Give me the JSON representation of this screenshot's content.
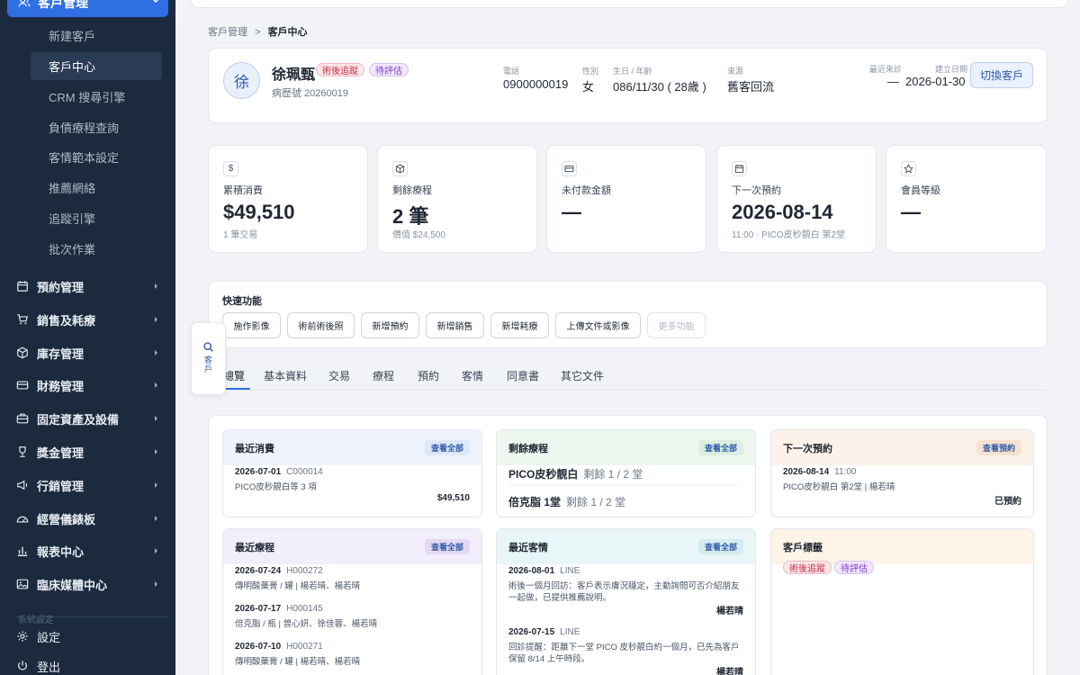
{
  "sidebar": {
    "active_group": "客戶管理",
    "sub_items": [
      "新建客戶",
      "客戶中心",
      "CRM 搜尋引擎",
      "負債療程查詢",
      "客情範本設定",
      "推薦網絡",
      "追蹤引擎",
      "批次作業"
    ],
    "main_items": [
      "預約管理",
      "銷售及耗療",
      "庫存管理",
      "財務管理",
      "固定資產及設備",
      "獎金管理",
      "行銷管理",
      "經營儀錶板",
      "報表中心",
      "臨床媒體中心"
    ],
    "faded_label": "系統設定",
    "footer": {
      "settings": "設定",
      "logout": "登出"
    }
  },
  "breadcrumb": {
    "parent": "客戶管理",
    "sep": ">",
    "current": "客戶中心"
  },
  "customer": {
    "avatar": "徐",
    "name": "徐珮甄",
    "badges": [
      "術後追蹤",
      "待評估"
    ],
    "record": "病歷號 20260019",
    "phone_label": "電話",
    "phone": "0900000019",
    "gender_label": "性別",
    "gender": "女",
    "birth_label": "生日 / 年齡",
    "birth": "086/11/30 ( 28歲 )",
    "source_label": "來源",
    "source": "舊客回流",
    "last_visit_label": "最近來診",
    "last_visit": "—",
    "created_label": "建立日期",
    "created": "2026-01-30",
    "switch_button": "切換客戶"
  },
  "stats": [
    {
      "title": "累積消費",
      "value": "$49,510",
      "sub": "1 筆交易",
      "icon": "dollar-icon"
    },
    {
      "title": "剩餘療程",
      "value": "2 筆",
      "sub": "價值 $24,500",
      "icon": "package-icon"
    },
    {
      "title": "未付款金額",
      "value": "—",
      "sub": "",
      "icon": "credit-card-icon"
    },
    {
      "title": "下一次預約",
      "value": "2026-08-14",
      "sub": "11:00 · PICO皮秒靚白 第2堂",
      "icon": "calendar-icon"
    },
    {
      "title": "會員等級",
      "value": "—",
      "sub": "",
      "icon": "star-icon"
    }
  ],
  "quick": {
    "title": "快速功能",
    "buttons": [
      "施作影像",
      "術前術後照",
      "新增預約",
      "新增銷售",
      "新增耗療",
      "上傳文件或影像",
      "更多功能"
    ]
  },
  "float_button": {
    "label": "客戶"
  },
  "tabs": [
    "總覽",
    "基本資料",
    "交易",
    "療程",
    "預約",
    "客情",
    "同意書",
    "其它文件"
  ],
  "panels": {
    "recent_spend": {
      "title": "最近消費",
      "action": "查看全部",
      "date": "2026-07-01",
      "code": "C000014",
      "desc": "PICO皮秒靚白等 3 項",
      "amount": "$49,510"
    },
    "remaining": {
      "title": "剩餘療程",
      "action": "查看全部",
      "items": [
        {
          "name": "PICO皮秒靚白",
          "rem": "剩餘 1 / 2 堂"
        },
        {
          "name": "倍克脂 1堂",
          "rem": "剩餘 1 / 2 堂"
        }
      ]
    },
    "next_appt": {
      "title": "下一次預約",
      "action": "查看預約",
      "date": "2026-08-14",
      "time": "11:00",
      "desc": "PICO皮秒靚白 第2堂 | 楊若晴",
      "status": "已預約"
    },
    "recent_treat": {
      "title": "最近療程",
      "action": "查看全部",
      "items": [
        {
          "date": "2026-07-24",
          "code": "H000272",
          "desc": "傳明酸藥膏 / 罐 | 楊若晴、楊若晴"
        },
        {
          "date": "2026-07-17",
          "code": "H000145",
          "desc": "倍克脂 / 瓶 | 曾心妍、徐佳蓉、楊若晴"
        },
        {
          "date": "2026-07-10",
          "code": "H000271",
          "desc": "傳明酸藥膏 / 罐 | 楊若晴、楊若晴"
        }
      ]
    },
    "recent_care": {
      "title": "最近客情",
      "action": "查看全部",
      "items": [
        {
          "date": "2026-08-01",
          "channel": "LINE",
          "line1": "術後一個月回訪：客戶表示膚況穩定，主動詢問可否介紹朋友",
          "line2": "一起做，已提供推薦說明。",
          "staff": "楊若晴"
        },
        {
          "date": "2026-07-15",
          "channel": "LINE",
          "line1": "回診提醒：距離下一堂 PICO 皮秒靚白約一個月，已先為客戶",
          "line2": "保留 8/14 上午時段。",
          "staff": "楊若晴"
        }
      ]
    },
    "tags": {
      "title": "客戶標籤",
      "items": [
        "術後追蹤",
        "待評估"
      ]
    }
  }
}
